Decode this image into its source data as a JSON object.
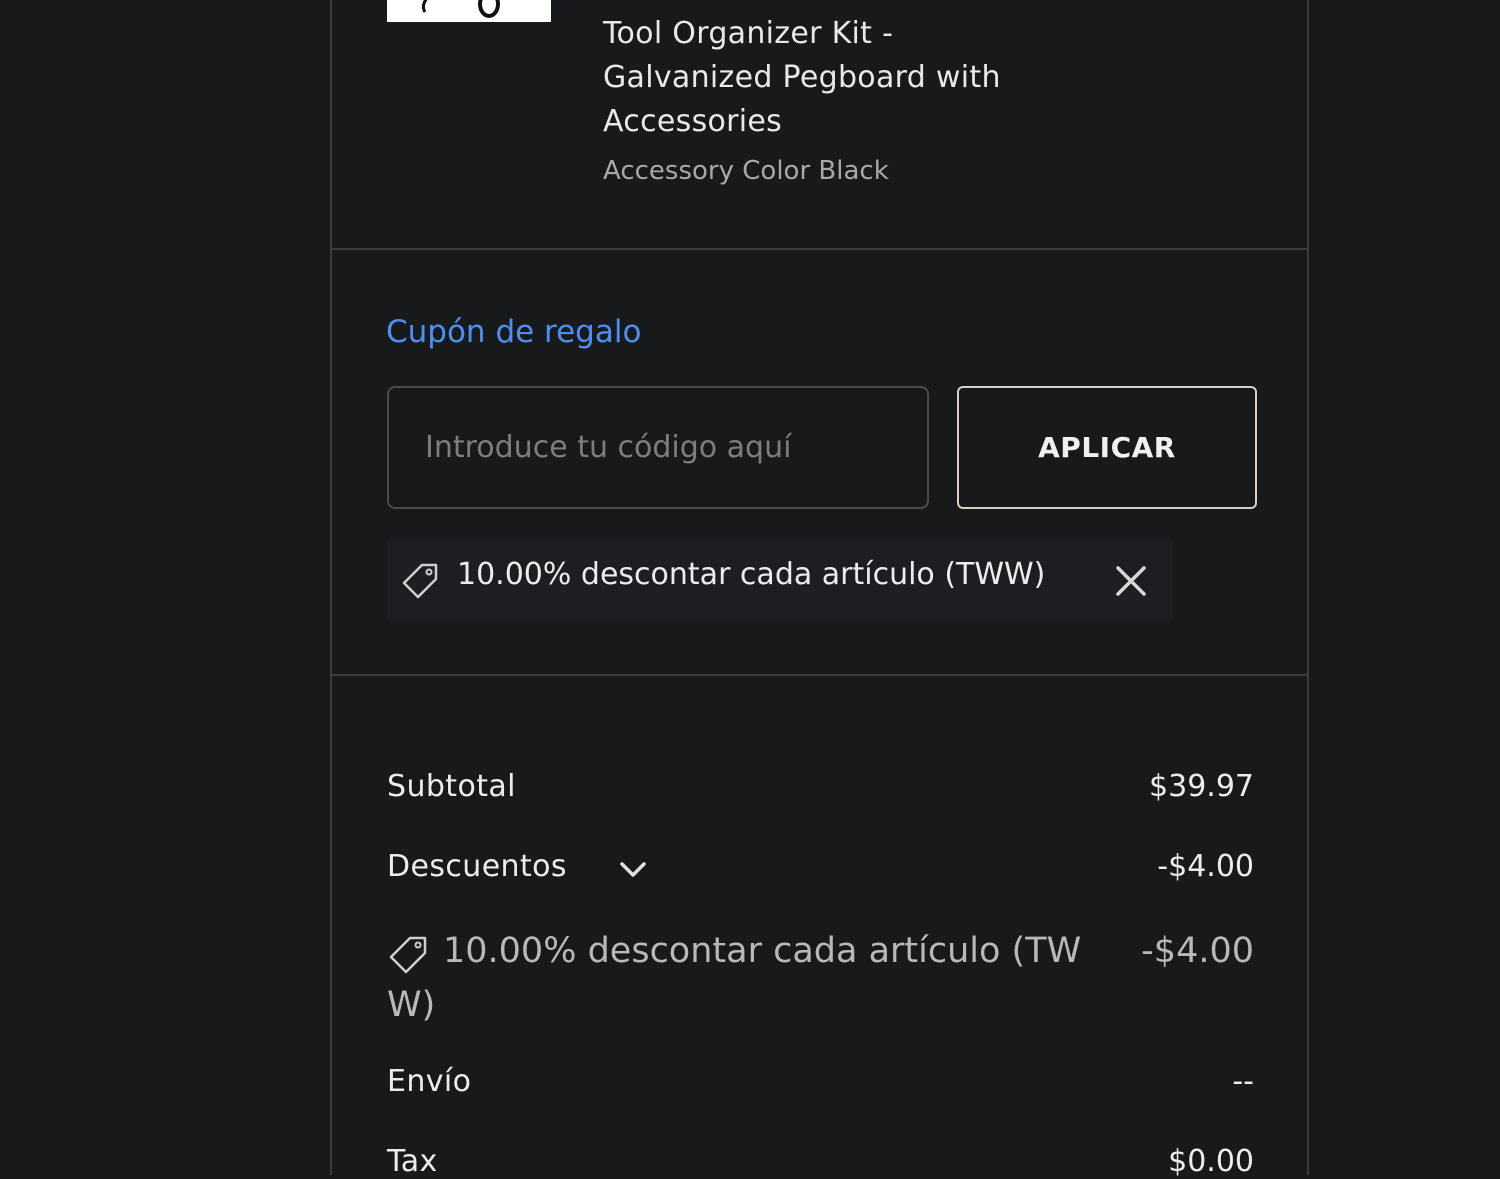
{
  "product": {
    "title_lines": [
      "Tool Organizer Kit -",
      "Galvanized Pegboard with",
      "Accessories"
    ],
    "variant": "Accessory Color Black",
    "thumbnail_icon": "product-image-icon"
  },
  "coupon": {
    "title": "Cupón de regalo",
    "input_placeholder": "Introduce tu código aquí",
    "input_value": "",
    "apply_label": "APLICAR",
    "applied_text": "10.00% descontar cada artículo (TWW)",
    "tag_icon": "tag-icon",
    "remove_icon": "close-icon"
  },
  "totals": {
    "subtotal_label": "Subtotal",
    "subtotal_value": "$39.97",
    "discounts_label": "Descuentos",
    "discounts_value": "-$4.00",
    "discount_detail_text": "10.00% descontar cada artículo (TWW)",
    "discount_detail_value": "-$4.00",
    "shipping_label": "Envío",
    "shipping_value": "--",
    "tax_label": "Tax",
    "tax_value": "$0.00"
  },
  "colors": {
    "background": "#18191b",
    "accent_link": "#4d8ff0",
    "border": "#3a3b3d",
    "text": "#ececec",
    "muted_text": "#a8a8a8"
  }
}
